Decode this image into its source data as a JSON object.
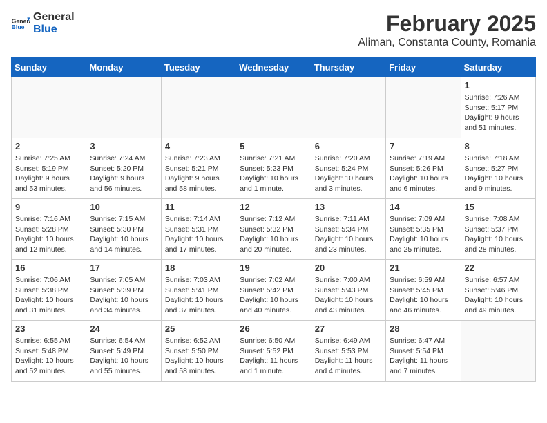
{
  "header": {
    "logo_general": "General",
    "logo_blue": "Blue",
    "month": "February 2025",
    "location": "Aliman, Constanta County, Romania"
  },
  "days_of_week": [
    "Sunday",
    "Monday",
    "Tuesday",
    "Wednesday",
    "Thursday",
    "Friday",
    "Saturday"
  ],
  "weeks": [
    [
      {
        "day": "",
        "info": ""
      },
      {
        "day": "",
        "info": ""
      },
      {
        "day": "",
        "info": ""
      },
      {
        "day": "",
        "info": ""
      },
      {
        "day": "",
        "info": ""
      },
      {
        "day": "",
        "info": ""
      },
      {
        "day": "1",
        "info": "Sunrise: 7:26 AM\nSunset: 5:17 PM\nDaylight: 9 hours and 51 minutes."
      }
    ],
    [
      {
        "day": "2",
        "info": "Sunrise: 7:25 AM\nSunset: 5:19 PM\nDaylight: 9 hours and 53 minutes."
      },
      {
        "day": "3",
        "info": "Sunrise: 7:24 AM\nSunset: 5:20 PM\nDaylight: 9 hours and 56 minutes."
      },
      {
        "day": "4",
        "info": "Sunrise: 7:23 AM\nSunset: 5:21 PM\nDaylight: 9 hours and 58 minutes."
      },
      {
        "day": "5",
        "info": "Sunrise: 7:21 AM\nSunset: 5:23 PM\nDaylight: 10 hours and 1 minute."
      },
      {
        "day": "6",
        "info": "Sunrise: 7:20 AM\nSunset: 5:24 PM\nDaylight: 10 hours and 3 minutes."
      },
      {
        "day": "7",
        "info": "Sunrise: 7:19 AM\nSunset: 5:26 PM\nDaylight: 10 hours and 6 minutes."
      },
      {
        "day": "8",
        "info": "Sunrise: 7:18 AM\nSunset: 5:27 PM\nDaylight: 10 hours and 9 minutes."
      }
    ],
    [
      {
        "day": "9",
        "info": "Sunrise: 7:16 AM\nSunset: 5:28 PM\nDaylight: 10 hours and 12 minutes."
      },
      {
        "day": "10",
        "info": "Sunrise: 7:15 AM\nSunset: 5:30 PM\nDaylight: 10 hours and 14 minutes."
      },
      {
        "day": "11",
        "info": "Sunrise: 7:14 AM\nSunset: 5:31 PM\nDaylight: 10 hours and 17 minutes."
      },
      {
        "day": "12",
        "info": "Sunrise: 7:12 AM\nSunset: 5:32 PM\nDaylight: 10 hours and 20 minutes."
      },
      {
        "day": "13",
        "info": "Sunrise: 7:11 AM\nSunset: 5:34 PM\nDaylight: 10 hours and 23 minutes."
      },
      {
        "day": "14",
        "info": "Sunrise: 7:09 AM\nSunset: 5:35 PM\nDaylight: 10 hours and 25 minutes."
      },
      {
        "day": "15",
        "info": "Sunrise: 7:08 AM\nSunset: 5:37 PM\nDaylight: 10 hours and 28 minutes."
      }
    ],
    [
      {
        "day": "16",
        "info": "Sunrise: 7:06 AM\nSunset: 5:38 PM\nDaylight: 10 hours and 31 minutes."
      },
      {
        "day": "17",
        "info": "Sunrise: 7:05 AM\nSunset: 5:39 PM\nDaylight: 10 hours and 34 minutes."
      },
      {
        "day": "18",
        "info": "Sunrise: 7:03 AM\nSunset: 5:41 PM\nDaylight: 10 hours and 37 minutes."
      },
      {
        "day": "19",
        "info": "Sunrise: 7:02 AM\nSunset: 5:42 PM\nDaylight: 10 hours and 40 minutes."
      },
      {
        "day": "20",
        "info": "Sunrise: 7:00 AM\nSunset: 5:43 PM\nDaylight: 10 hours and 43 minutes."
      },
      {
        "day": "21",
        "info": "Sunrise: 6:59 AM\nSunset: 5:45 PM\nDaylight: 10 hours and 46 minutes."
      },
      {
        "day": "22",
        "info": "Sunrise: 6:57 AM\nSunset: 5:46 PM\nDaylight: 10 hours and 49 minutes."
      }
    ],
    [
      {
        "day": "23",
        "info": "Sunrise: 6:55 AM\nSunset: 5:48 PM\nDaylight: 10 hours and 52 minutes."
      },
      {
        "day": "24",
        "info": "Sunrise: 6:54 AM\nSunset: 5:49 PM\nDaylight: 10 hours and 55 minutes."
      },
      {
        "day": "25",
        "info": "Sunrise: 6:52 AM\nSunset: 5:50 PM\nDaylight: 10 hours and 58 minutes."
      },
      {
        "day": "26",
        "info": "Sunrise: 6:50 AM\nSunset: 5:52 PM\nDaylight: 11 hours and 1 minute."
      },
      {
        "day": "27",
        "info": "Sunrise: 6:49 AM\nSunset: 5:53 PM\nDaylight: 11 hours and 4 minutes."
      },
      {
        "day": "28",
        "info": "Sunrise: 6:47 AM\nSunset: 5:54 PM\nDaylight: 11 hours and 7 minutes."
      },
      {
        "day": "",
        "info": ""
      }
    ]
  ]
}
